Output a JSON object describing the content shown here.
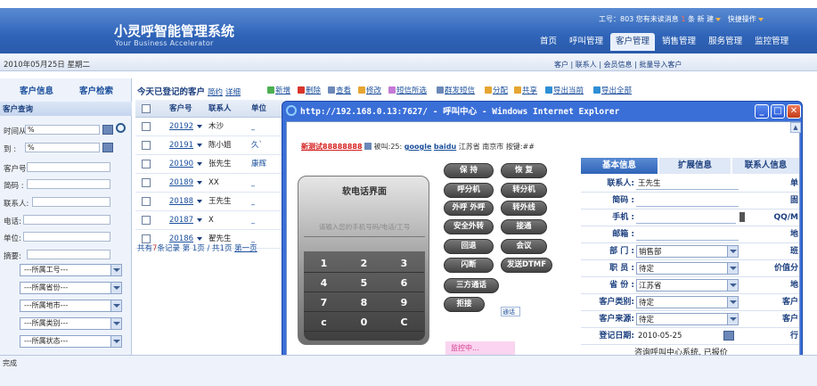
{
  "app": {
    "title": "小灵呼智能管理系统",
    "subtitle": "Your Business Accelerator"
  },
  "user_bar": {
    "worker": "工号：803 您有未读消息",
    "count": "1",
    "suffix": "条",
    "new": "新",
    "build": "建",
    "quick": "快捷操作"
  },
  "nav": {
    "tabs": [
      {
        "label": "首页"
      },
      {
        "label": "呼叫管理"
      },
      {
        "label": "客户管理"
      },
      {
        "label": "销售管理"
      },
      {
        "label": "服务管理"
      },
      {
        "label": "监控管理"
      }
    ],
    "active_index": 2
  },
  "date": "2010年05月25日 星期二",
  "sublinks": "客户 | 联系人 | 会员信息 | 批量导入客户",
  "sidebar": {
    "tab_info": "客户信息",
    "tab_search": "客户检索",
    "section": "客户查询",
    "fields": {
      "time_from": {
        "label": "时间从 :",
        "value": "%"
      },
      "time_to": {
        "label": "到 :",
        "value": "%"
      },
      "customer_no": {
        "label": "客户号:"
      },
      "short_code": {
        "label": "简码 :"
      },
      "contact": {
        "label": "联系人:"
      },
      "phone": {
        "label": "电话:"
      },
      "company": {
        "label": "单位:"
      },
      "summary": {
        "label": "摘要:"
      }
    },
    "selects": [
      "---所属工号---",
      "---所属省份---",
      "---所属地市---",
      "---所属类别---",
      "---所属状态---"
    ]
  },
  "list": {
    "title": "今天已登记的客户",
    "link_brief": "简约",
    "link_detail": "详细",
    "toolbar": [
      "新增",
      "删除",
      "查看",
      "修改",
      "短信所选",
      "群发短信",
      "分配",
      "共享",
      "导出当前",
      "导出全部"
    ],
    "columns": [
      "客户号",
      "联系人",
      "单位"
    ],
    "rows": [
      {
        "no": "20192",
        "contact": "木沙",
        "unit": "_"
      },
      {
        "no": "20191",
        "contact": "陈小姐",
        "unit": "久`"
      },
      {
        "no": "20190",
        "contact": "张先生",
        "unit": "康辉"
      },
      {
        "no": "20189",
        "contact": "XX",
        "unit": "_"
      },
      {
        "no": "20188",
        "contact": "王先生",
        "unit": "_"
      },
      {
        "no": "20187",
        "contact": "X",
        "unit": "_"
      },
      {
        "no": "20186",
        "contact": "翟先生",
        "unit": "_"
      }
    ],
    "pager_a": "共有",
    "pager_count": "7",
    "pager_b": "条记录 第",
    "pager_page": "1",
    "pager_c": "页 / 共1页",
    "pager_first": "第一页"
  },
  "popup": {
    "title": "http://192.168.0.13:7627/ - 呼叫中心 - Windows Internet Explorer",
    "callbar": {
      "caller": "新测试88888888",
      "mid": "被叫:25:",
      "google": "google",
      "baidu": "baidu",
      "location": "江苏省 南京市 按键:##"
    },
    "phone": {
      "title": "软电话界面",
      "placeholder": "请输入您的手机号码/电话/工号",
      "keys": [
        "1",
        "2",
        "3",
        "4",
        "5",
        "6",
        "7",
        "8",
        "9",
        "c",
        "0",
        "C"
      ]
    },
    "functions": [
      "保 持",
      "恢 复",
      "呼分机",
      "转分机",
      "外呼 外呼",
      "转外线",
      "安全外转",
      "接通",
      "回退",
      "会议",
      "闪断",
      "发送DTMF",
      "三方通话",
      "拒接"
    ],
    "monitor_input": "通话",
    "monitor": "监控中...",
    "info_tabs": [
      "基本信息",
      "扩展信息",
      "联系人信息"
    ],
    "info": {
      "contact": {
        "label": "联系人:",
        "value": "王先生"
      },
      "short_code": {
        "label": "简码 :"
      },
      "mobile": {
        "label": "手机 :"
      },
      "email": {
        "label": "邮箱 :"
      },
      "dept": {
        "label": "部 门 :",
        "value": "销售部"
      },
      "position": {
        "label": "职 员 :",
        "value": "待定"
      },
      "province": {
        "label": "省 份 :",
        "value": "江苏省"
      },
      "category": {
        "label": "客户类别:",
        "value": "待定"
      },
      "source": {
        "label": "客户来源:",
        "value": "待定"
      },
      "reg_date": {
        "label": "登记日期:",
        "value": "2010-05-25"
      },
      "note": "咨询呼叫中心系统, 已报价"
    },
    "right_labels": [
      "单",
      "固",
      "QQ/M",
      "地",
      "班",
      "价值分",
      "地",
      "客户",
      "客户",
      "行"
    ]
  },
  "status": "完成",
  "colors": {
    "header": "#2f64b8",
    "accent": "#1b4f9c",
    "ie": "#3a6fd8"
  }
}
